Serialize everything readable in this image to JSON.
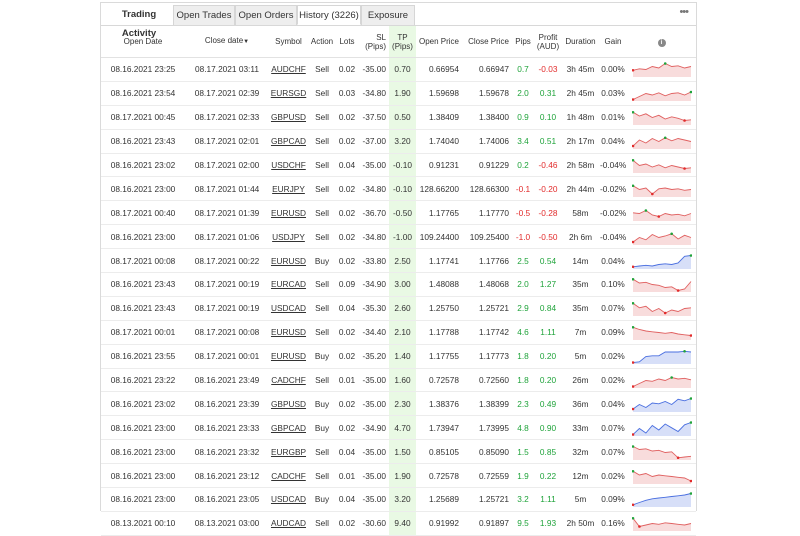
{
  "tabs": [
    {
      "label": "Trading Activity"
    },
    {
      "label": "Open Trades"
    },
    {
      "label": "Open Orders"
    },
    {
      "label": "History (3226)"
    },
    {
      "label": "Exposure"
    }
  ],
  "menu": {
    "icon": "more-dots-icon",
    "glyph": "•••"
  },
  "columns": {
    "open_date": "Open Date",
    "close_date": "Close date",
    "close_sort_glyph": "▼",
    "symbol": "Symbol",
    "action": "Action",
    "lots": "Lots",
    "sl": "SL (Pips)",
    "tp": "TP (Pips)",
    "open_price": "Open Price",
    "close_price": "Close Price",
    "pips": "Pips",
    "profit": "Profit (AUD)",
    "duration": "Duration",
    "gain": "Gain",
    "info_glyph": "i"
  },
  "colors": {
    "positive": "#1fa33a",
    "negative": "#e22b2b",
    "spark_red": "#e06060",
    "spark_blue": "#4a6fe0"
  },
  "trades": [
    {
      "open_date": "08.16.2021 23:25",
      "close_date": "08.17.2021 03:11",
      "symbol": "AUDCHF",
      "action": "Sell",
      "lots": "0.02",
      "sl": "-35.00",
      "tp": "0.70",
      "open_price": "0.66954",
      "close_price": "0.66947",
      "pips": "0.7",
      "profit": "-0.03",
      "duration": "3h 45m",
      "gain": "0.00%",
      "spark": [
        0.45,
        0.55,
        0.5,
        0.7,
        0.6,
        0.9,
        0.7,
        0.75,
        0.6,
        0.7
      ]
    },
    {
      "open_date": "08.16.2021 23:54",
      "close_date": "08.17.2021 02:39",
      "symbol": "EURSGD",
      "action": "Sell",
      "lots": "0.03",
      "sl": "-34.80",
      "tp": "1.90",
      "open_price": "1.59698",
      "close_price": "1.59678",
      "pips": "2.0",
      "profit": "0.31",
      "duration": "2h 45m",
      "gain": "0.03%",
      "spark": [
        0.1,
        0.3,
        0.5,
        0.4,
        0.55,
        0.35,
        0.5,
        0.55,
        0.4,
        0.6
      ]
    },
    {
      "open_date": "08.17.2021 00:45",
      "close_date": "08.17.2021 02:33",
      "symbol": "GBPUSD",
      "action": "Sell",
      "lots": "0.02",
      "sl": "-37.50",
      "tp": "0.50",
      "open_price": "1.38409",
      "close_price": "1.38400",
      "pips": "0.9",
      "profit": "0.10",
      "duration": "1h 48m",
      "gain": "0.01%",
      "spark": [
        0.85,
        0.6,
        0.75,
        0.5,
        0.65,
        0.4,
        0.55,
        0.45,
        0.3,
        0.35
      ]
    },
    {
      "open_date": "08.16.2021 23:43",
      "close_date": "08.17.2021 02:01",
      "symbol": "GBPCAD",
      "action": "Sell",
      "lots": "0.02",
      "sl": "-37.00",
      "tp": "3.20",
      "open_price": "1.74040",
      "close_price": "1.74006",
      "pips": "3.4",
      "profit": "0.51",
      "duration": "2h 17m",
      "gain": "0.04%",
      "spark": [
        0.2,
        0.6,
        0.4,
        0.7,
        0.5,
        0.75,
        0.55,
        0.7,
        0.6,
        0.5
      ]
    },
    {
      "open_date": "08.16.2021 23:02",
      "close_date": "08.17.2021 02:00",
      "symbol": "USDCHF",
      "action": "Sell",
      "lots": "0.04",
      "sl": "-35.00",
      "tp": "-0.10",
      "open_price": "0.91231",
      "close_price": "0.91229",
      "pips": "0.2",
      "profit": "-0.46",
      "duration": "2h 58m",
      "gain": "-0.04%",
      "spark": [
        0.85,
        0.5,
        0.6,
        0.4,
        0.55,
        0.35,
        0.5,
        0.4,
        0.3,
        0.35
      ]
    },
    {
      "open_date": "08.16.2021 23:00",
      "close_date": "08.17.2021 01:44",
      "symbol": "EURJPY",
      "action": "Sell",
      "lots": "0.02",
      "sl": "-34.80",
      "tp": "-0.10",
      "open_price": "128.66200",
      "close_price": "128.66300",
      "pips": "-0.1",
      "profit": "-0.20",
      "duration": "2h 44m",
      "gain": "-0.02%",
      "spark": [
        0.75,
        0.5,
        0.6,
        0.2,
        0.55,
        0.6,
        0.5,
        0.55,
        0.45,
        0.5
      ]
    },
    {
      "open_date": "08.17.2021 00:40",
      "close_date": "08.17.2021 01:39",
      "symbol": "EURUSD",
      "action": "Sell",
      "lots": "0.02",
      "sl": "-36.70",
      "tp": "-0.50",
      "open_price": "1.17765",
      "close_price": "1.17770",
      "pips": "-0.5",
      "profit": "-0.28",
      "duration": "58m",
      "gain": "-0.02%",
      "spark": [
        0.55,
        0.5,
        0.7,
        0.4,
        0.3,
        0.5,
        0.4,
        0.45,
        0.35,
        0.5
      ]
    },
    {
      "open_date": "08.16.2021 23:00",
      "close_date": "08.17.2021 01:06",
      "symbol": "USDJPY",
      "action": "Sell",
      "lots": "0.02",
      "sl": "-34.80",
      "tp": "-1.00",
      "open_price": "109.24400",
      "close_price": "109.25400",
      "pips": "-1.0",
      "profit": "-0.50",
      "duration": "2h 6m",
      "gain": "-0.04%",
      "spark": [
        0.2,
        0.5,
        0.35,
        0.7,
        0.5,
        0.6,
        0.75,
        0.4,
        0.65,
        0.5
      ]
    },
    {
      "open_date": "08.17.2021 00:08",
      "close_date": "08.17.2021 00:22",
      "symbol": "EURUSD",
      "action": "Buy",
      "lots": "0.02",
      "sl": "-33.80",
      "tp": "2.50",
      "open_price": "1.17741",
      "close_price": "1.17766",
      "pips": "2.5",
      "profit": "0.54",
      "duration": "14m",
      "gain": "0.04%",
      "spark": [
        0.15,
        0.2,
        0.25,
        0.2,
        0.3,
        0.35,
        0.3,
        0.4,
        0.85,
        0.9
      ]
    },
    {
      "open_date": "08.16.2021 23:43",
      "close_date": "08.17.2021 00:19",
      "symbol": "EURCAD",
      "action": "Sell",
      "lots": "0.09",
      "sl": "-34.90",
      "tp": "3.00",
      "open_price": "1.48088",
      "close_price": "1.48068",
      "pips": "2.0",
      "profit": "1.27",
      "duration": "35m",
      "gain": "0.10%",
      "spark": [
        0.85,
        0.6,
        0.65,
        0.5,
        0.45,
        0.3,
        0.35,
        0.1,
        0.2,
        0.7
      ]
    },
    {
      "open_date": "08.16.2021 23:43",
      "close_date": "08.17.2021 00:19",
      "symbol": "USDCAD",
      "action": "Sell",
      "lots": "0.04",
      "sl": "-35.30",
      "tp": "2.60",
      "open_price": "1.25750",
      "close_price": "1.25721",
      "pips": "2.9",
      "profit": "0.84",
      "duration": "35m",
      "gain": "0.07%",
      "spark": [
        0.85,
        0.55,
        0.65,
        0.3,
        0.5,
        0.2,
        0.4,
        0.3,
        0.5,
        0.55
      ]
    },
    {
      "open_date": "08.17.2021 00:01",
      "close_date": "08.17.2021 00:08",
      "symbol": "EURUSD",
      "action": "Sell",
      "lots": "0.02",
      "sl": "-34.40",
      "tp": "2.10",
      "open_price": "1.17788",
      "close_price": "1.17742",
      "pips": "4.6",
      "profit": "1.11",
      "duration": "7m",
      "gain": "0.09%",
      "spark": [
        0.85,
        0.7,
        0.6,
        0.55,
        0.5,
        0.45,
        0.5,
        0.4,
        0.35,
        0.3
      ]
    },
    {
      "open_date": "08.16.2021 23:55",
      "close_date": "08.17.2021 00:01",
      "symbol": "EURUSD",
      "action": "Buy",
      "lots": "0.02",
      "sl": "-35.20",
      "tp": "1.40",
      "open_price": "1.17755",
      "close_price": "1.17773",
      "pips": "1.8",
      "profit": "0.20",
      "duration": "5m",
      "gain": "0.02%",
      "spark": [
        0.1,
        0.15,
        0.5,
        0.55,
        0.55,
        0.8,
        0.8,
        0.8,
        0.85,
        0.8
      ]
    },
    {
      "open_date": "08.16.2021 23:22",
      "close_date": "08.16.2021 23:49",
      "symbol": "CADCHF",
      "action": "Sell",
      "lots": "0.01",
      "sl": "-35.00",
      "tp": "1.60",
      "open_price": "0.72578",
      "close_price": "0.72560",
      "pips": "1.8",
      "profit": "0.20",
      "duration": "26m",
      "gain": "0.02%",
      "spark": [
        0.1,
        0.3,
        0.5,
        0.45,
        0.6,
        0.5,
        0.7,
        0.6,
        0.65,
        0.55
      ]
    },
    {
      "open_date": "08.16.2021 23:02",
      "close_date": "08.16.2021 23:39",
      "symbol": "GBPUSD",
      "action": "Buy",
      "lots": "0.02",
      "sl": "-35.00",
      "tp": "2.30",
      "open_price": "1.38376",
      "close_price": "1.38399",
      "pips": "2.3",
      "profit": "0.49",
      "duration": "36m",
      "gain": "0.04%",
      "spark": [
        0.2,
        0.5,
        0.3,
        0.6,
        0.55,
        0.7,
        0.5,
        0.85,
        0.75,
        0.9
      ]
    },
    {
      "open_date": "08.16.2021 23:00",
      "close_date": "08.16.2021 23:33",
      "symbol": "GBPCAD",
      "action": "Buy",
      "lots": "0.02",
      "sl": "-34.90",
      "tp": "4.70",
      "open_price": "1.73947",
      "close_price": "1.73995",
      "pips": "4.8",
      "profit": "0.90",
      "duration": "33m",
      "gain": "0.07%",
      "spark": [
        0.1,
        0.5,
        0.2,
        0.7,
        0.4,
        0.8,
        0.55,
        0.3,
        0.75,
        0.9
      ]
    },
    {
      "open_date": "08.16.2021 23:00",
      "close_date": "08.16.2021 23:32",
      "symbol": "EURGBP",
      "action": "Sell",
      "lots": "0.04",
      "sl": "-35.00",
      "tp": "1.50",
      "open_price": "0.85105",
      "close_price": "0.85090",
      "pips": "1.5",
      "profit": "0.85",
      "duration": "32m",
      "gain": "0.07%",
      "spark": [
        0.9,
        0.7,
        0.75,
        0.6,
        0.65,
        0.5,
        0.55,
        0.15,
        0.2,
        0.25
      ]
    },
    {
      "open_date": "08.16.2021 23:00",
      "close_date": "08.16.2021 23:12",
      "symbol": "CADCHF",
      "action": "Sell",
      "lots": "0.01",
      "sl": "-35.00",
      "tp": "1.90",
      "open_price": "0.72578",
      "close_price": "0.72559",
      "pips": "1.9",
      "profit": "0.22",
      "duration": "12m",
      "gain": "0.02%",
      "spark": [
        0.85,
        0.6,
        0.7,
        0.5,
        0.6,
        0.55,
        0.5,
        0.45,
        0.4,
        0.2
      ]
    },
    {
      "open_date": "08.16.2021 23:00",
      "close_date": "08.16.2021 23:05",
      "symbol": "USDCAD",
      "action": "Buy",
      "lots": "0.04",
      "sl": "-35.00",
      "tp": "3.20",
      "open_price": "1.25689",
      "close_price": "1.25721",
      "pips": "3.2",
      "profit": "1.11",
      "duration": "5m",
      "gain": "0.09%",
      "spark": [
        0.15,
        0.3,
        0.45,
        0.55,
        0.6,
        0.65,
        0.7,
        0.75,
        0.8,
        0.9
      ]
    },
    {
      "open_date": "08.13.2021 00:10",
      "close_date": "08.13.2021 03:00",
      "symbol": "AUDCAD",
      "action": "Sell",
      "lots": "0.02",
      "sl": "-30.60",
      "tp": "9.40",
      "open_price": "0.91992",
      "close_price": "0.91897",
      "pips": "9.5",
      "profit": "1.93",
      "duration": "2h 50m",
      "gain": "0.16%",
      "spark": [
        0.85,
        0.3,
        0.4,
        0.5,
        0.45,
        0.55,
        0.5,
        0.45,
        0.4,
        0.5
      ]
    }
  ]
}
